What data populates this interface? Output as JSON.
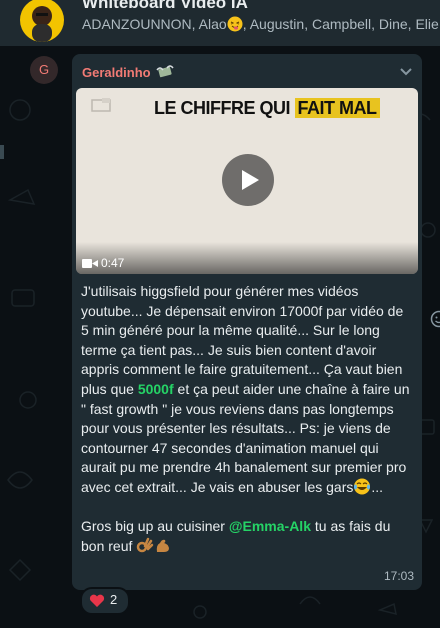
{
  "header": {
    "title": "Whiteboard Vidéo IA",
    "members_prefix": "ADANZOUNNON, Alao",
    "members_suffix": ", Augustin, Campbell, Dine, Elie, Em"
  },
  "message": {
    "sender_initial": "G",
    "sender_name": "Geraldinho",
    "video": {
      "headline_part1": "LE CHIFFRE QUI",
      "headline_part2": "FAIT MAL",
      "duration": "0:47"
    },
    "text": {
      "part1": "J'utilisais higgsfield pour générer mes vidéos youtube... Je dépensait environ 17000f par vidéo de 5 min généré pour la même qualité... Sur le long terme ça tient pas... Je suis bien content d'avoir appris comment le faire gratuitement... Ça vaut bien plus que ",
      "money": "5000f",
      "part2": " et ça peut aider une chaîne à faire un \" fast growth \" je vous reviens dans pas longtemps pour vous présenter les résultats... Ps: je viens de contourner 47 secondes d'animation manuel qui aurait pu me prendre 4h banalement sur premier pro avec cet extrait... Je vais en abuser les gars",
      "part3": "...",
      "part4": "Gros big up au cuisiner ",
      "mention": "@Emma-Alk",
      "part5": "  tu as fais du bon reuf "
    },
    "time": "17:03"
  },
  "reaction": {
    "emoji": "heart-icon",
    "count": "2"
  },
  "colors": {
    "background": "#0b1014",
    "bubble": "#1f2c33",
    "sender_name": "#f27b75",
    "accent_green": "#25d366"
  }
}
